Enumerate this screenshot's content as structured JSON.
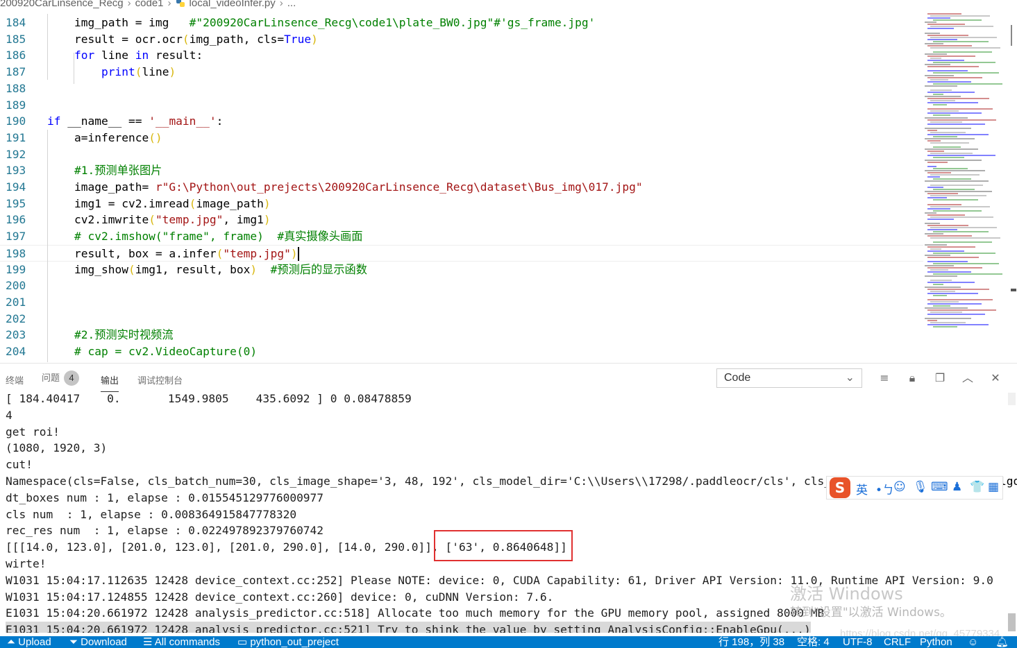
{
  "breadcrumb": {
    "folder": "200920CarLinsence_Recg",
    "subfolder": "code1",
    "file": "local_videoInfer.py",
    "more": "..."
  },
  "editor": {
    "lines": [
      {
        "n": "184",
        "code": [
          {
            "t": "    img_path = img   "
          },
          {
            "t": "#\"200920CarLinsence_Recg\\code1\\plate_BW0.jpg\"#'gs_frame.jpg'",
            "c": "cmt"
          }
        ]
      },
      {
        "n": "185",
        "code": [
          {
            "t": "    result = ocr.ocr"
          },
          {
            "t": "(",
            "c": "paren"
          },
          {
            "t": "img_path, cls="
          },
          {
            "t": "True",
            "c": "kw"
          },
          {
            "t": ")",
            "c": "paren"
          }
        ]
      },
      {
        "n": "186",
        "code": [
          {
            "t": "    "
          },
          {
            "t": "for",
            "c": "kw"
          },
          {
            "t": " line "
          },
          {
            "t": "in",
            "c": "kw"
          },
          {
            "t": " result:"
          }
        ]
      },
      {
        "n": "187",
        "code": [
          {
            "t": "        "
          },
          {
            "t": "print",
            "c": "kw"
          },
          {
            "t": "(",
            "c": "paren"
          },
          {
            "t": "line"
          },
          {
            "t": ")",
            "c": "paren"
          }
        ]
      },
      {
        "n": "188",
        "code": []
      },
      {
        "n": "189",
        "code": []
      },
      {
        "n": "190",
        "code": [
          {
            "t": "if",
            "c": "kw"
          },
          {
            "t": " __name__ == "
          },
          {
            "t": "'__main__'",
            "c": "str"
          },
          {
            "t": ":"
          }
        ]
      },
      {
        "n": "191",
        "code": [
          {
            "t": "    a=inference"
          },
          {
            "t": "()",
            "c": "paren"
          }
        ]
      },
      {
        "n": "192",
        "code": []
      },
      {
        "n": "193",
        "code": [
          {
            "t": "    #1.预测单张图片",
            "c": "cmt"
          }
        ]
      },
      {
        "n": "194",
        "code": [
          {
            "t": "    image_path= "
          },
          {
            "t": "r\"G:\\Python\\out_prejects\\200920CarLinsence_Recg\\dataset\\Bus_img\\017.jpg\"",
            "c": "str"
          }
        ]
      },
      {
        "n": "195",
        "code": [
          {
            "t": "    img1 = cv2.imread"
          },
          {
            "t": "(",
            "c": "paren"
          },
          {
            "t": "image_path"
          },
          {
            "t": ")",
            "c": "paren"
          }
        ]
      },
      {
        "n": "196",
        "code": [
          {
            "t": "    cv2.imwrite"
          },
          {
            "t": "(",
            "c": "paren"
          },
          {
            "t": "\"temp.jpg\"",
            "c": "str"
          },
          {
            "t": ", img1"
          },
          {
            "t": ")",
            "c": "paren"
          }
        ]
      },
      {
        "n": "197",
        "code": [
          {
            "t": "    # cv2.imshow(\"frame\", frame)  #真实摄像头画面",
            "c": "cmt"
          }
        ]
      },
      {
        "n": "198",
        "code": [
          {
            "t": "    result, box = a.infer"
          },
          {
            "t": "(",
            "c": "paren"
          },
          {
            "t": "\"temp.jpg\"",
            "c": "str"
          },
          {
            "t": ")",
            "c": "paren"
          }
        ],
        "current": true
      },
      {
        "n": "199",
        "code": [
          {
            "t": "    img_show"
          },
          {
            "t": "(",
            "c": "paren"
          },
          {
            "t": "img1, result, box"
          },
          {
            "t": ")",
            "c": "paren"
          },
          {
            "t": "  #预测后的显示函数",
            "c": "cmt"
          }
        ]
      },
      {
        "n": "200",
        "code": []
      },
      {
        "n": "201",
        "code": []
      },
      {
        "n": "202",
        "code": []
      },
      {
        "n": "203",
        "code": [
          {
            "t": "    #2.预测实时视频流",
            "c": "cmt"
          }
        ]
      },
      {
        "n": "204",
        "code": [
          {
            "t": "    # cap = cv2.VideoCapture(0)",
            "c": "cmt"
          }
        ]
      }
    ]
  },
  "panel": {
    "tabs": [
      {
        "label": "终端"
      },
      {
        "label": "问题",
        "badge": "4"
      },
      {
        "label": "输出",
        "active": true
      },
      {
        "label": "调试控制台"
      }
    ],
    "output_channel": "Code",
    "output_lines": [
      "[ 184.40417    0.       1549.9805    435.6092 ] 0 0.08478859",
      "4",
      "get roi!",
      "(1080, 1920, 3)",
      "cut!",
      "Namespace(cls=False, cls_batch_num=30, cls_image_shape='3, 48, 192', cls_model_dir='C:\\\\Users\\\\17298/.paddleocr/cls', cls_th",
      "dt_boxes num : 1, elapse : 0.015545129776000977",
      "cls num  : 1, elapse : 0.008364915847778320",
      "rec_res num  : 1, elapse : 0.022497892379760742",
      "[[[14.0, 123.0], [201.0, 123.0], [201.0, 290.0], [14.0, 290.0]], ['63', 0.8640648]]",
      "wirte!",
      "W1031 15:04:17.112635 12428 device_context.cc:252] Please NOTE: device: 0, CUDA Capability: 61, Driver API Version: 11.0, Runtime API Version: 9.0",
      "W1031 15:04:17.124855 12428 device_context.cc:260] device: 0, cuDNN Version: 7.6.",
      "E1031 15:04:20.661972 12428 analysis_predictor.cc:518] Allocate too much memory for the GPU memory pool, assigned 8000 MB",
      "E1031 15:04:20.661972 12428 analysis_predictor.cc:521] Try to shink the value by setting AnalysisConfig::EnableGpu(...)"
    ],
    "output_tail_visible": "lgo"
  },
  "ime": {
    "logo": "S",
    "items": [
      "英",
      "•ㄅ",
      "☺",
      "🎙",
      "⌨",
      "♟",
      "👕",
      "▦"
    ]
  },
  "watermark": {
    "title": "激活 Windows",
    "subtitle": "转到\"设置\"以激活 Windows。",
    "blog": "https://blog.csdn.net/qq_45779334"
  },
  "statusbar": {
    "upload": "Upload",
    "download": "Download",
    "all_commands": "All commands",
    "workspace": "python_out_preject",
    "position": "行 198，列 38",
    "spaces": "空格: 4",
    "encoding": "UTF-8",
    "eol": "CRLF",
    "language": "Python"
  },
  "colors": {
    "statusbar": "#007acc",
    "keyword": "#0000ff",
    "string": "#a31515",
    "comment": "#008000",
    "highlight_box": "#e03030"
  }
}
